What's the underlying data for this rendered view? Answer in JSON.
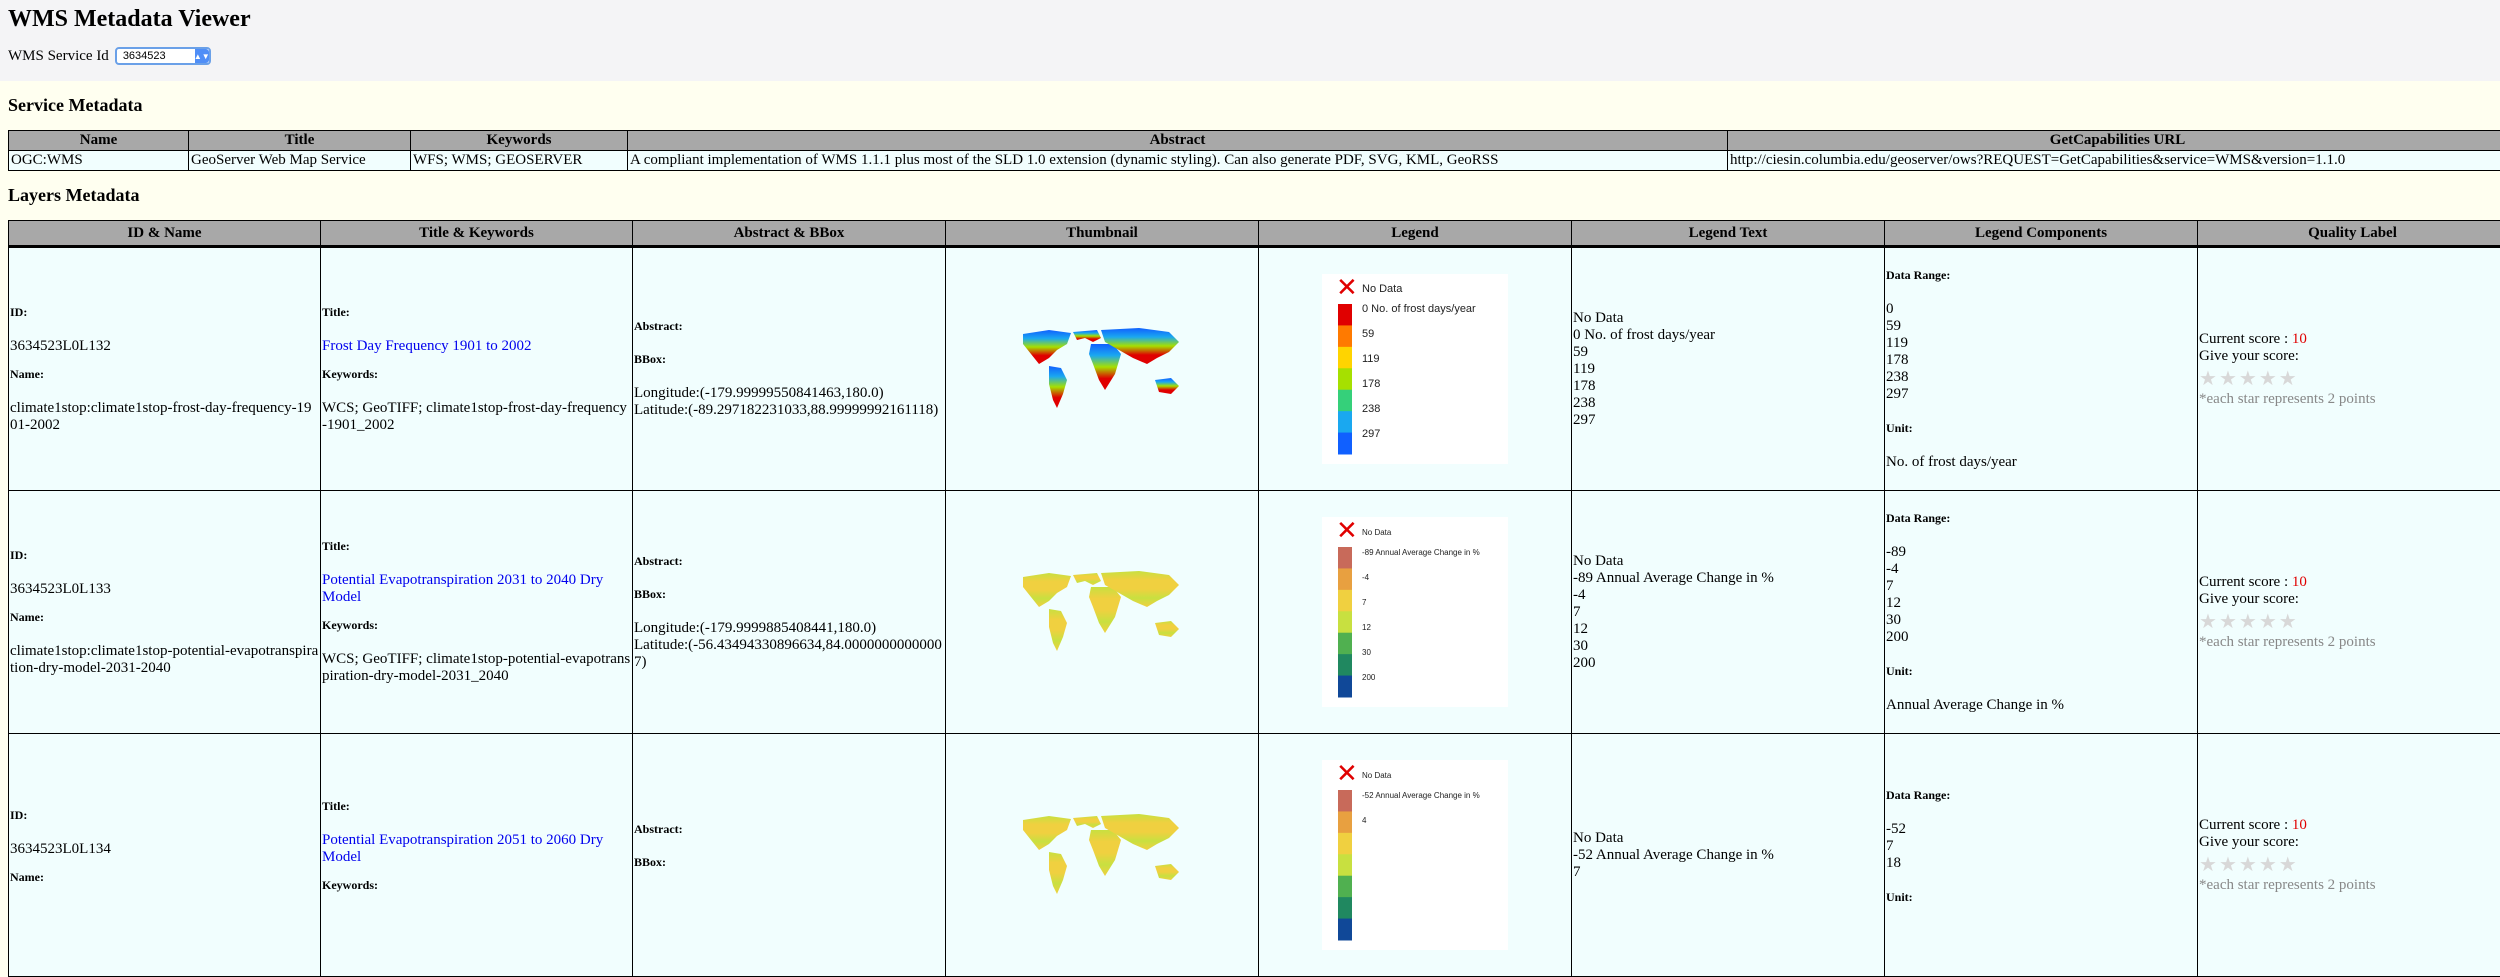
{
  "app": {
    "title": "WMS Metadata Viewer"
  },
  "service_selector": {
    "label": "WMS Service Id",
    "value": "3634523"
  },
  "service_section": {
    "heading": "Service Metadata",
    "columns": [
      "Name",
      "Title",
      "Keywords",
      "Abstract",
      "GetCapabilities URL"
    ],
    "row": {
      "name": "OGC:WMS",
      "title": "GeoServer Web Map Service",
      "keywords": "WFS; WMS; GEOSERVER",
      "abstract": "A compliant implementation of WMS 1.1.1 plus most of the SLD 1.0 extension (dynamic styling). Can also generate PDF, SVG, KML, GeoRSS",
      "url": "http://ciesin.columbia.edu/geoserver/ows?REQUEST=GetCapabilities&service=WMS&version=1.1.0"
    }
  },
  "layers_section": {
    "heading": "Layers Metadata",
    "columns": [
      "ID & Name",
      "Title & Keywords",
      "Abstract & BBox",
      "Thumbnail",
      "Legend",
      "Legend Text",
      "Legend Components",
      "Quality Label"
    ],
    "labels": {
      "id": "ID:",
      "name": "Name:",
      "title": "Title:",
      "keywords": "Keywords:",
      "abstract": "Abstract:",
      "bbox": "BBox:",
      "data_range": "Data Range:",
      "unit": "Unit:",
      "current_score": "Current score : ",
      "give_score": "Give your score:",
      "star_note": "*each star represents 2 points"
    },
    "rows": [
      {
        "id": "3634523L0L132",
        "name": "climate1stop:climate1stop-frost-day-frequency-1901-2002",
        "title": "Frost Day Frequency 1901 to 2002",
        "keywords": "WCS; GeoTIFF; climate1stop-frost-day-frequency-1901_2002",
        "longitude": "Longitude:(-179.99999550841463,180.0)",
        "latitude": "Latitude:(-89.297182231033,88.99999992161118)",
        "legend_text": [
          "No Data",
          "0 No. of frost days/year",
          "59",
          "119",
          "178",
          "238",
          "297"
        ],
        "legend_labels": [
          "No Data",
          "0 No. of frost days/year",
          "59",
          "119",
          "178",
          "238",
          "297"
        ],
        "data_range": [
          "0",
          "59",
          "119",
          "178",
          "238",
          "297"
        ],
        "unit": "No. of frost days/year",
        "score": "10",
        "stars": 0
      },
      {
        "id": "3634523L0L133",
        "name": "climate1stop:climate1stop-potential-evapotranspiration-dry-model-2031-2040",
        "title": "Potential Evapotranspiration 2031 to 2040 Dry Model",
        "keywords": "WCS; GeoTIFF; climate1stop-potential-evapotranspiration-dry-model-2031_2040",
        "longitude": "Longitude:(-179.9999885408441,180.0)",
        "latitude": "Latitude:(-56.43494330896634,84.00000000000007)",
        "legend_text": [
          "No Data",
          "-89 Annual Average Change in %",
          "-4",
          "7",
          "12",
          "30",
          "200"
        ],
        "legend_labels": [
          "No Data",
          "-89 Annual Average Change in %",
          "-4",
          "7",
          "12",
          "30",
          "200"
        ],
        "data_range": [
          "-89",
          "-4",
          "7",
          "12",
          "30",
          "200"
        ],
        "unit": "Annual Average Change in %",
        "score": "10",
        "stars": 0
      },
      {
        "id": "3634523L0L134",
        "name": "",
        "title": "Potential Evapotranspiration 2051 to 2060 Dry Model",
        "keywords": "",
        "longitude": "",
        "latitude": "",
        "legend_text": [
          "No Data",
          "-52 Annual Average Change in %",
          "7"
        ],
        "legend_labels": [
          "No Data",
          "-52 Annual Average Change in %",
          "4"
        ],
        "data_range": [
          "-52",
          "7",
          "18"
        ],
        "unit": "",
        "score": "10",
        "stars": 0
      }
    ]
  },
  "colors": {
    "link": "#0000ee",
    "score": "#e00000",
    "header_bg": "#a8a8a8",
    "cell_bg": "#f1fefe",
    "page_bg": "#fffff0",
    "frost_ramp": [
      "#e00000",
      "#ff7a00",
      "#ffd400",
      "#a6e000",
      "#35d07a",
      "#1aa8f0",
      "#1060ff"
    ],
    "pet_ramp": [
      "#c86a5a",
      "#e8a040",
      "#f0d040",
      "#c8e040",
      "#50b050",
      "#208860",
      "#104898"
    ]
  },
  "icons": {
    "select_chevron": "chevron-updown-icon",
    "star": "star-icon",
    "no_data": "x-mark-icon"
  }
}
